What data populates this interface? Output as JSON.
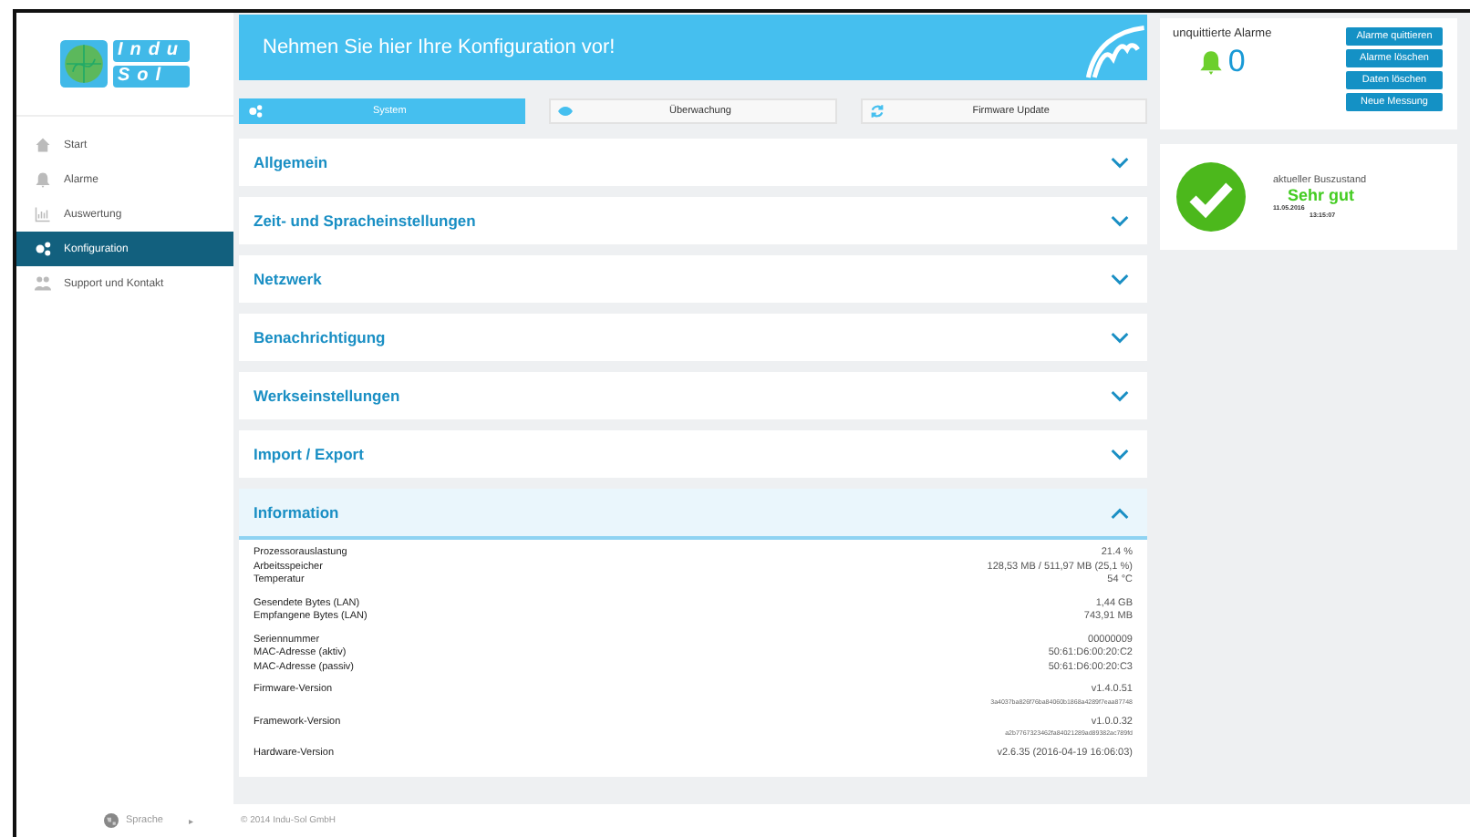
{
  "logo": {
    "lines": [
      "Indu",
      "Sol"
    ]
  },
  "sidebar": {
    "items": [
      {
        "label": "Start",
        "kind": "home",
        "selected": false
      },
      {
        "label": "Alarme",
        "kind": "bell",
        "selected": false
      },
      {
        "label": "Auswertung",
        "kind": "chart",
        "selected": false
      },
      {
        "label": "Konfiguration",
        "kind": "gears",
        "selected": true
      },
      {
        "label": "Support und Kontakt",
        "kind": "people",
        "selected": false
      }
    ]
  },
  "banner": {
    "title": "Nehmen Sie hier Ihre Konfiguration vor!"
  },
  "tabs": [
    {
      "label": "System",
      "kind": "gears",
      "selected": true
    },
    {
      "label": "Überwachung",
      "kind": "eye",
      "selected": false
    },
    {
      "label": "Firmware Update",
      "kind": "refresh",
      "selected": false
    }
  ],
  "sections": [
    {
      "title": "Allgemein",
      "expanded": false
    },
    {
      "title": "Zeit- und Spracheinstellungen",
      "expanded": false
    },
    {
      "title": "Netzwerk",
      "expanded": false
    },
    {
      "title": "Benachrichtigung",
      "expanded": false
    },
    {
      "title": "Werkseinstellungen",
      "expanded": false
    },
    {
      "title": "Import / Export",
      "expanded": false
    },
    {
      "title": "Information",
      "expanded": true
    }
  ],
  "information": {
    "groups": [
      {
        "rows": [
          {
            "label": "Prozessorauslastung",
            "value": "21.4 %"
          },
          {
            "label": "Arbeitsspeicher",
            "value": "128,53 MB / 511,97 MB (25,1 %)"
          },
          {
            "label": "Temperatur",
            "value": "54 °C"
          }
        ]
      },
      {
        "rows": [
          {
            "label": "Gesendete Bytes (LAN)",
            "value": "1,44 GB"
          },
          {
            "label": "Empfangene Bytes (LAN)",
            "value": "743,91 MB"
          }
        ]
      },
      {
        "rows": [
          {
            "label": "Seriennummer",
            "value": "00000009"
          },
          {
            "label": "MAC-Adresse (aktiv)",
            "value": "50:61:D6:00:20:C2"
          },
          {
            "label": "MAC-Adresse (passiv)",
            "value": "50:61:D6:00:20:C3"
          }
        ]
      },
      {
        "rows": [
          {
            "label": "Firmware-Version",
            "value": "v1.4.0.51",
            "detail": "3a4037ba826f76ba84060b1868a4289f7eaa87748"
          }
        ]
      },
      {
        "rows": [
          {
            "label": "Framework-Version",
            "value": "v1.0.0.32",
            "detail": "a2b7767323462fa84021289ad89382ac789fd"
          }
        ]
      },
      {
        "rows": [
          {
            "label": "Hardware-Version",
            "value": "v2.6.35 (2016-04-19 16:06:03)"
          }
        ]
      }
    ]
  },
  "alarms": {
    "title": "unquittierte Alarme",
    "count": "0",
    "buttons": [
      "Alarme quittieren",
      "Alarme löschen",
      "Daten löschen",
      "Neue Messung"
    ]
  },
  "bus": {
    "title": "aktueller Buszustand",
    "status": "Sehr gut",
    "date": "11.05.2016",
    "time": "13:15:07"
  },
  "footer": {
    "language": "Sprache",
    "arrow": "▸",
    "copyright": "© 2014 Indu-Sol GmbH"
  }
}
